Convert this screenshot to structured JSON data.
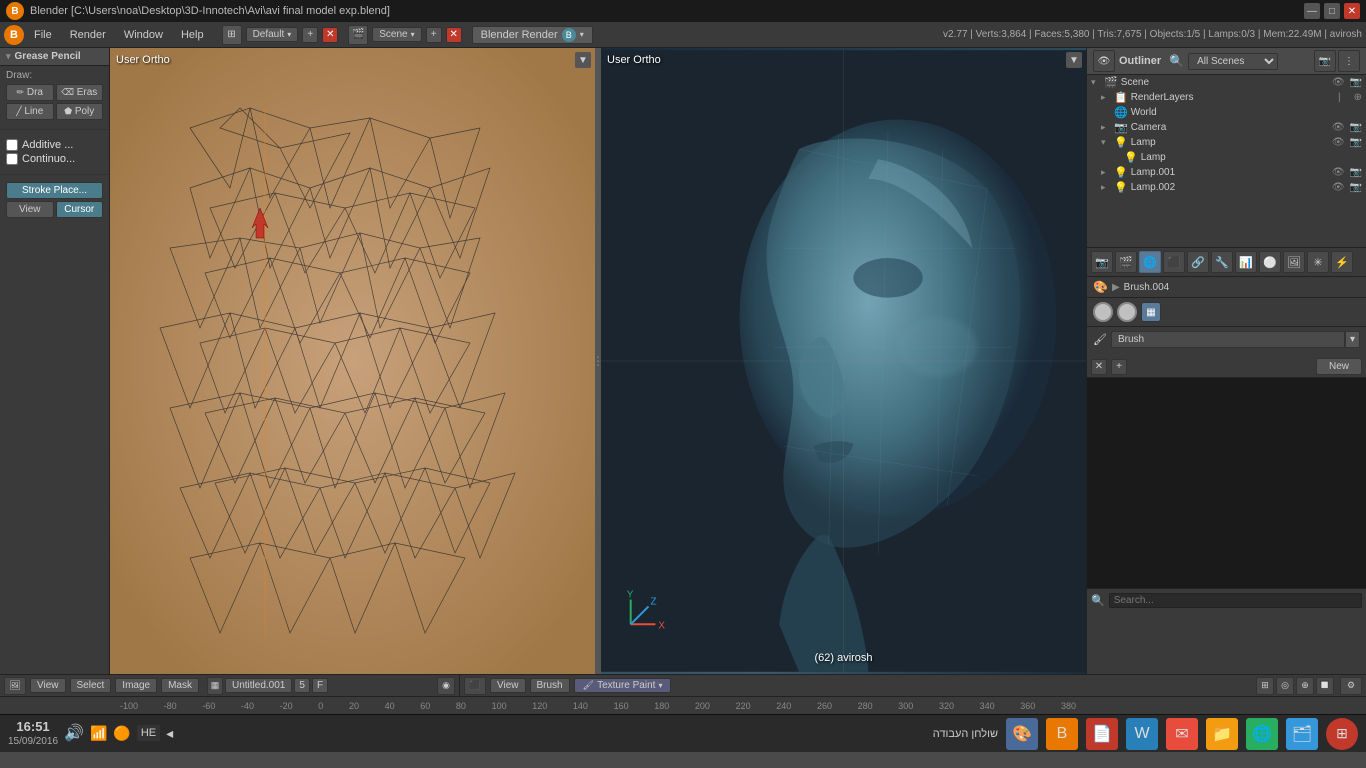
{
  "titlebar": {
    "title": "Blender  [C:\\Users\\noa\\Desktop\\3D-Innotech\\Avi\\avi final model exp.blend]",
    "minimize": "—",
    "maximize": "□",
    "close": "✕"
  },
  "menubar": {
    "logo": "B",
    "items": [
      "File",
      "Render",
      "Window",
      "Help"
    ],
    "layout_label": "Default",
    "scene_label": "Scene",
    "render_engine": "Blender Render",
    "info": "v2.77 | Verts:3,864 | Faces:5,380 | Tris:7,675 | Objects:1/5 | Lamps:0/3 | Mem:22.49M | avirosh"
  },
  "grease_pencil": {
    "header": "Grease Pencil",
    "draw_label": "Draw:",
    "buttons": {
      "draw": "Dra",
      "erase": "Eras",
      "line": "Line",
      "poly": "Poly"
    },
    "additive_label": "Additive ...",
    "continuous_label": "Continuo...",
    "stroke_place": "Stroke Place...",
    "view_btn": "View",
    "cursor_btn": "Cursor"
  },
  "uv_editor": {
    "label": "User Ortho",
    "toggle": "▼"
  },
  "viewport_3d": {
    "label": "User Ortho",
    "toggle": "▼",
    "info": "(62) avirosh"
  },
  "outliner": {
    "title": "Outliner",
    "search_placeholder": "Search",
    "scene_dropdown": "All Scenes",
    "items": [
      {
        "label": "Scene",
        "indent": 0,
        "icon": "🎬",
        "expand": "▾"
      },
      {
        "label": "RenderLayers",
        "indent": 1,
        "icon": "📷",
        "expand": "▸"
      },
      {
        "label": "World",
        "indent": 1,
        "icon": "🌐",
        "expand": ""
      },
      {
        "label": "Camera",
        "indent": 1,
        "icon": "📷",
        "expand": "▸"
      },
      {
        "label": "Lamp",
        "indent": 1,
        "icon": "💡",
        "expand": "▾"
      },
      {
        "label": "Lamp",
        "indent": 2,
        "icon": "💡",
        "expand": ""
      },
      {
        "label": "Lamp.001",
        "indent": 1,
        "icon": "💡",
        "expand": "▸"
      },
      {
        "label": "Lamp.002",
        "indent": 1,
        "icon": "💡",
        "expand": "▸"
      }
    ]
  },
  "properties": {
    "path": "Brush.004",
    "brush_label": "Brush",
    "new_btn": "New",
    "icons": [
      "🔧",
      "🎨",
      "🖼",
      "🔦",
      "⚙",
      "📐",
      "🔲",
      "💠",
      "🌈",
      "🔳",
      "📊"
    ]
  },
  "bottom_uv": {
    "view_btn": "View",
    "select_btn": "Select",
    "image_btn": "Image",
    "mask_btn": "Mask",
    "frame_label": "Untitled.001",
    "frame_num": "5",
    "frame_f": "F"
  },
  "bottom_vp": {
    "view_btn": "View",
    "brush_btn": "Brush",
    "mode_btn": "Texture Paint"
  },
  "ruler": {
    "marks": [
      "-100",
      "-80",
      "-60",
      "-40",
      "-20",
      "0",
      "20",
      "40",
      "60",
      "80",
      "100",
      "120",
      "140",
      "160",
      "180",
      "200",
      "220",
      "240",
      "260",
      "280",
      "300",
      "320",
      "340",
      "360",
      "380"
    ]
  },
  "taskbar": {
    "time": "16:51",
    "date": "15/09/2016",
    "lang": "HE",
    "workspace": "שולחן העבודה",
    "arrow": "◂"
  }
}
